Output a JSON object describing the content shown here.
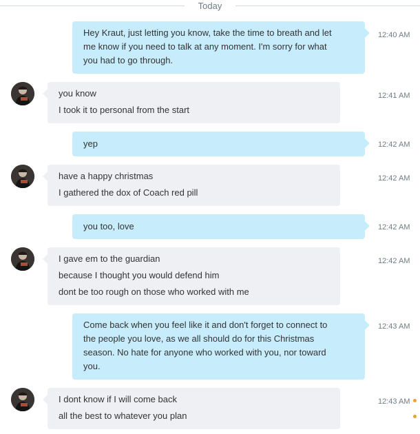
{
  "divider": {
    "label": "Today"
  },
  "messages": [
    {
      "direction": "out",
      "time": "12:40 AM",
      "lines": [
        "Hey Kraut, just letting you know, take the time to breath and let",
        "me know if you need to talk at any moment. I'm sorry for what",
        "you had to go through."
      ]
    },
    {
      "direction": "in",
      "time": "12:41 AM",
      "lines": [
        "you know",
        "I took it to personal from the start"
      ]
    },
    {
      "direction": "out",
      "time": "12:42 AM",
      "lines": [
        "yep"
      ]
    },
    {
      "direction": "in",
      "time": "12:42 AM",
      "lines": [
        "have a happy christmas",
        "I gathered the dox of Coach red pill"
      ]
    },
    {
      "direction": "out",
      "time": "12:42 AM",
      "lines": [
        "you too, love"
      ]
    },
    {
      "direction": "in",
      "time": "12:42 AM",
      "lines": [
        "I gave em to the guardian",
        "because I thought you would defend him",
        "dont be too rough on those who worked with me"
      ]
    },
    {
      "direction": "out",
      "time": "12:43 AM",
      "lines": [
        "Come back when you feel like it and don't forget to connect to",
        "the people you love, as we all should do for this Christmas",
        "season. No hate for anyone who worked with you, nor toward",
        "you."
      ]
    },
    {
      "direction": "in",
      "time": "12:43 AM",
      "lines": [
        "I dont know if I will come back",
        "all the best to whatever you plan"
      ]
    }
  ],
  "colors": {
    "outgoing_bubble": "#c7ecfc",
    "incoming_bubble": "#eef0f3",
    "status_dot": "#f0a030"
  }
}
